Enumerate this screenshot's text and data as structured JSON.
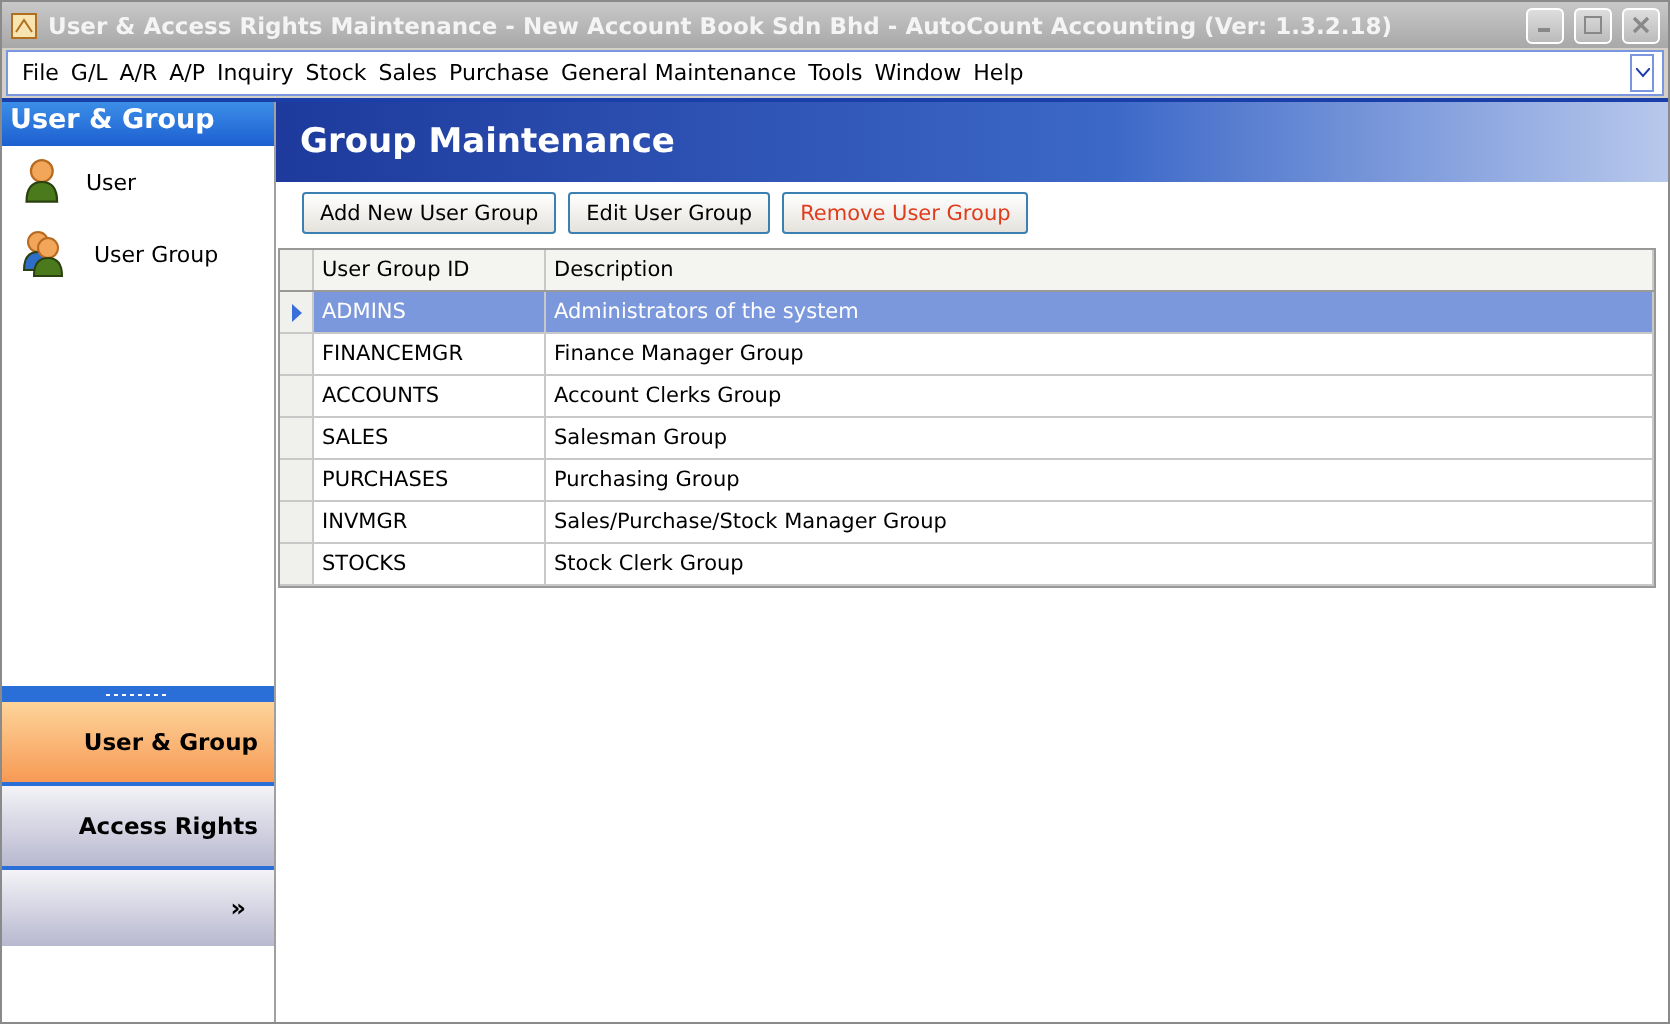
{
  "window": {
    "title": "User & Access Rights Maintenance - New Account Book Sdn Bhd - AutoCount Accounting (Ver: 1.3.2.18)"
  },
  "menu": [
    "File",
    "G/L",
    "A/R",
    "A/P",
    "Inquiry",
    "Stock",
    "Sales",
    "Purchase",
    "General Maintenance",
    "Tools",
    "Window",
    "Help"
  ],
  "sidebar": {
    "title": "User & Group",
    "items": [
      {
        "label": "User",
        "kind": "user"
      },
      {
        "label": "User Group",
        "kind": "group"
      }
    ],
    "nav": [
      {
        "label": "User & Group",
        "selected": true
      },
      {
        "label": "Access Rights",
        "selected": false
      }
    ],
    "more": "»"
  },
  "main": {
    "title": "Group Maintenance",
    "buttons": [
      {
        "label": "Add New User Group",
        "kind": "normal"
      },
      {
        "label": "Edit User Group",
        "kind": "normal"
      },
      {
        "label": "Remove User Group",
        "kind": "danger"
      }
    ],
    "table": {
      "columns": [
        "User Group ID",
        "Description"
      ],
      "rows": [
        {
          "cells": [
            "ADMINS",
            "Administrators of the system"
          ],
          "selected": true
        },
        {
          "cells": [
            "FINANCEMGR",
            "Finance Manager Group"
          ],
          "selected": false
        },
        {
          "cells": [
            "ACCOUNTS",
            "Account Clerks Group"
          ],
          "selected": false
        },
        {
          "cells": [
            "SALES",
            "Salesman Group"
          ],
          "selected": false
        },
        {
          "cells": [
            "PURCHASES",
            "Purchasing Group"
          ],
          "selected": false
        },
        {
          "cells": [
            "INVMGR",
            "Sales/Purchase/Stock Manager Group"
          ],
          "selected": false
        },
        {
          "cells": [
            "STOCKS",
            "Stock Clerk Group"
          ],
          "selected": false
        }
      ]
    }
  }
}
